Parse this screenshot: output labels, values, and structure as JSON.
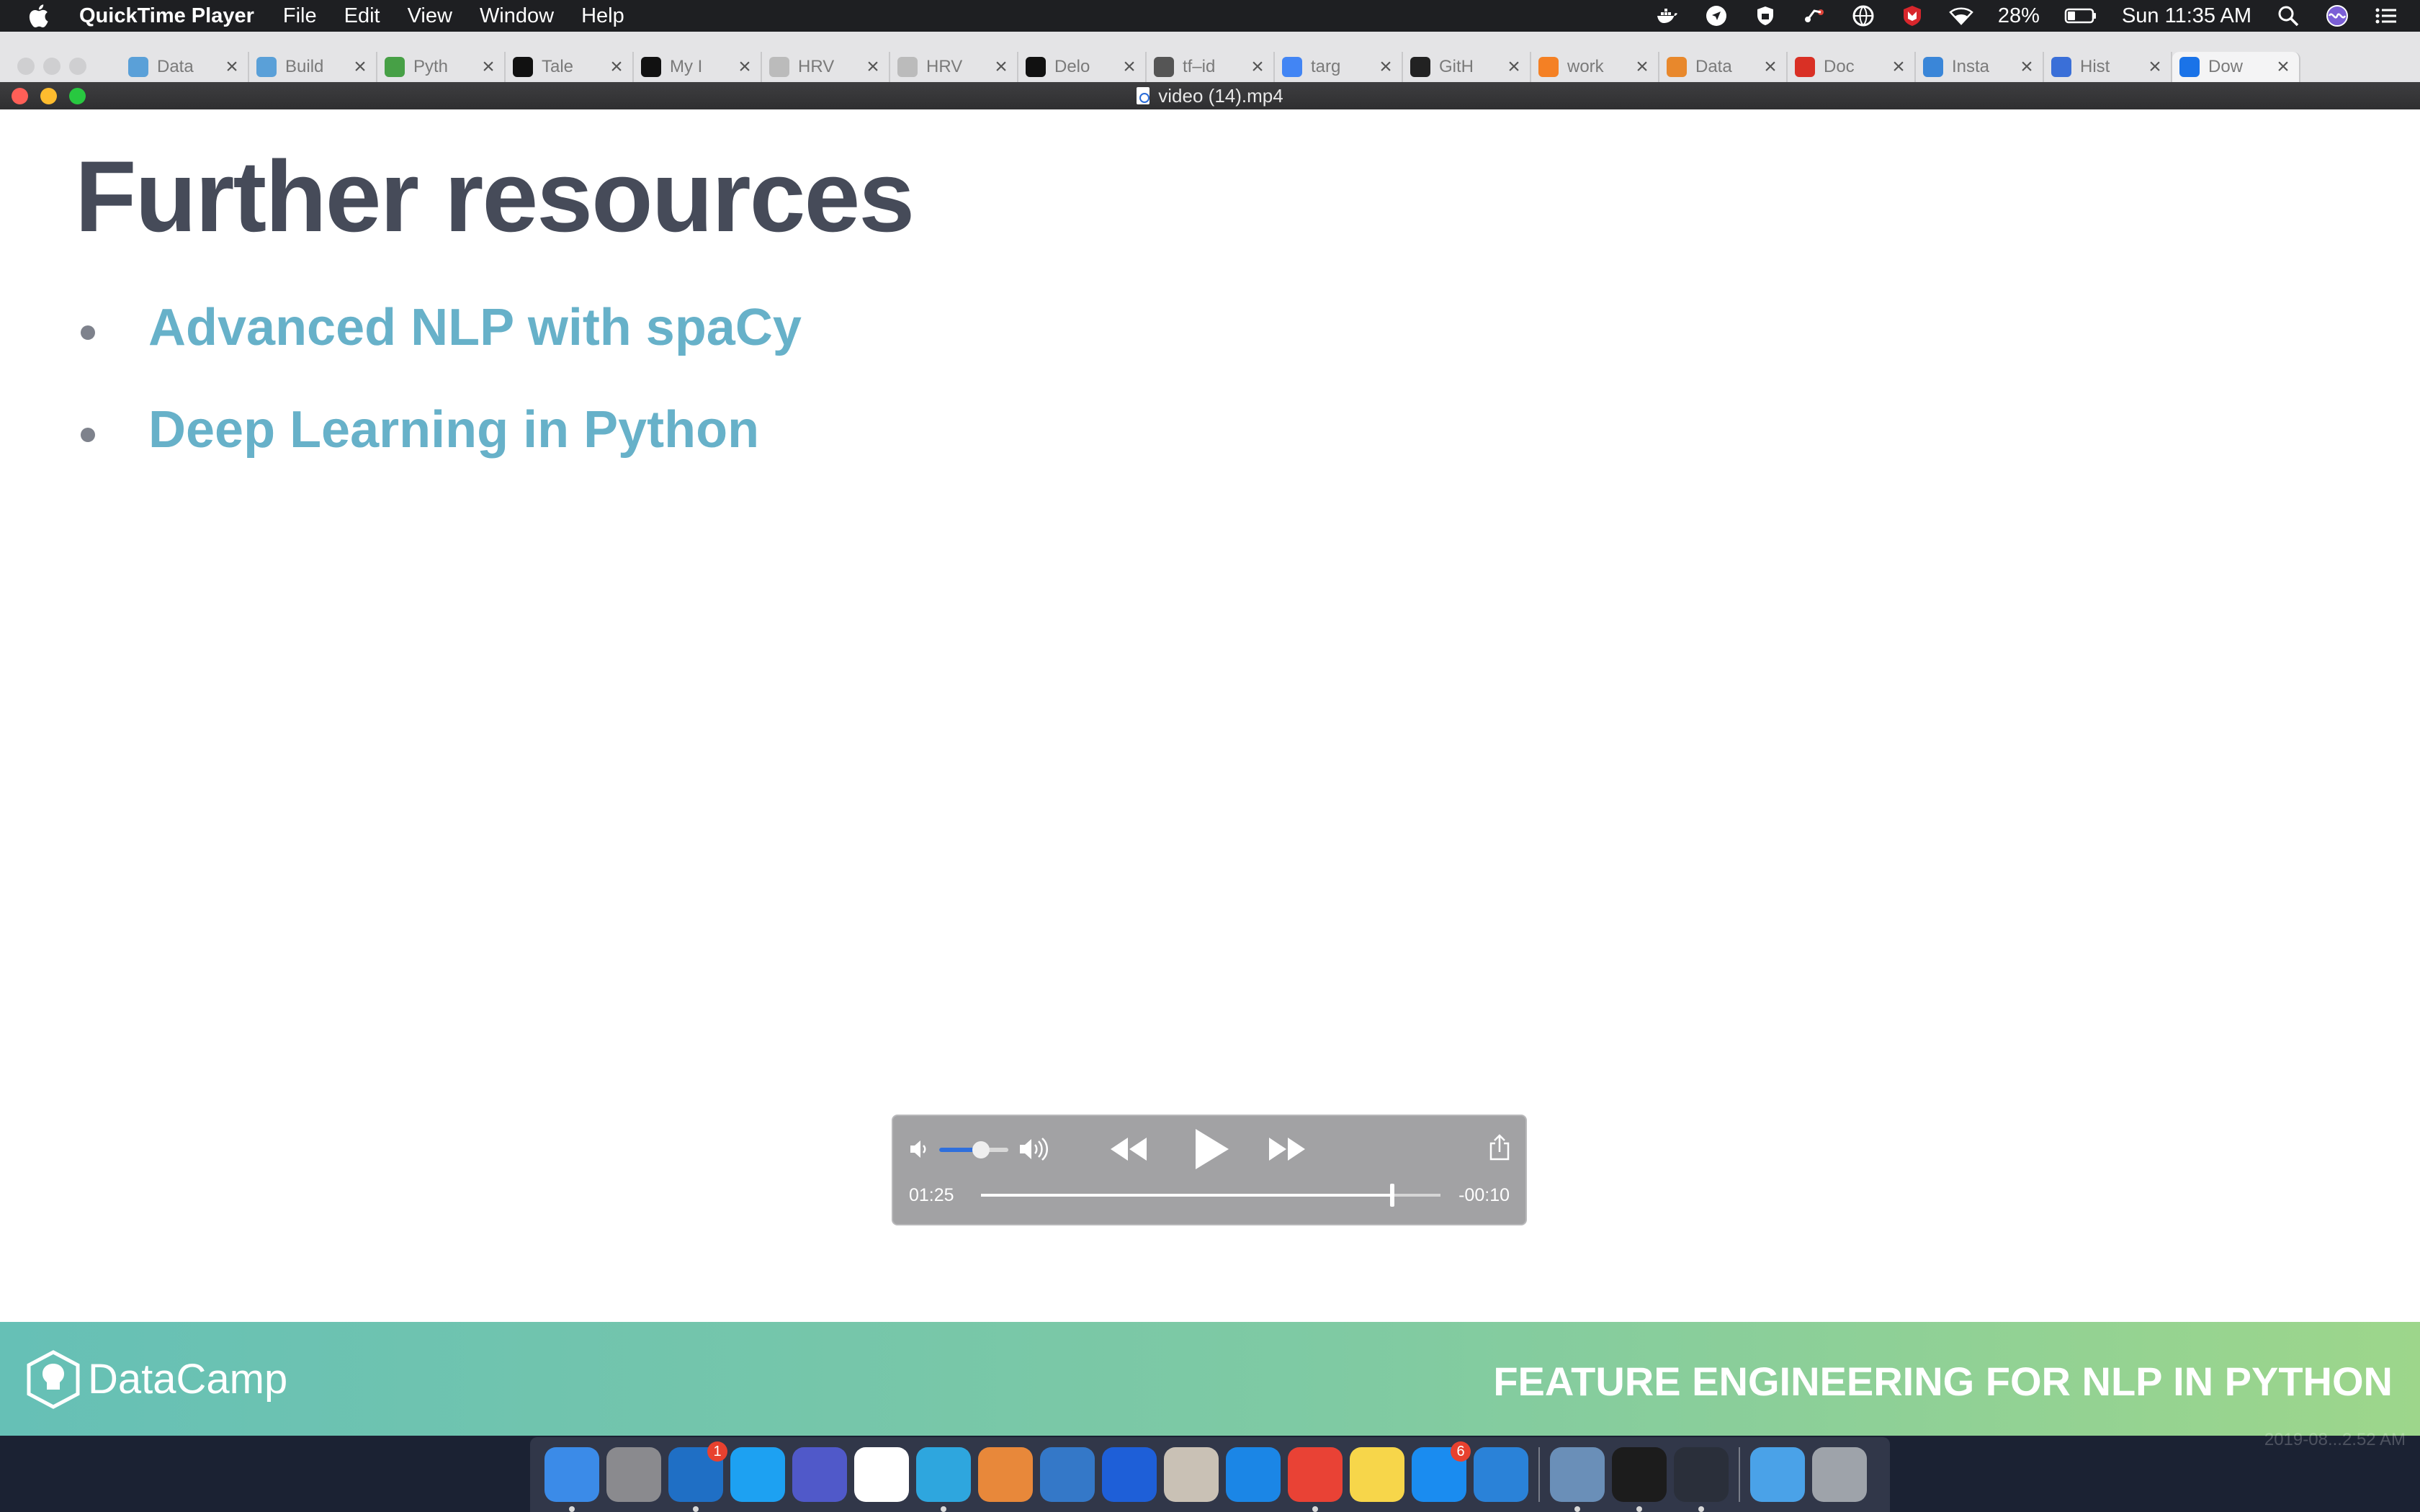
{
  "menubar": {
    "app_name": "QuickTime Player",
    "items": [
      "File",
      "Edit",
      "View",
      "Window",
      "Help"
    ],
    "battery": "28%",
    "clock": "Sun 11:35 AM",
    "status_icons": [
      "docker-icon",
      "navigation-icon",
      "shield-icon",
      "activity-icon",
      "globe-vpn-icon",
      "mcafee-icon",
      "wifi-icon",
      "battery-icon",
      "spotlight-search-icon",
      "siri-icon",
      "notification-center-icon"
    ]
  },
  "browser_tabs": [
    {
      "title": "Data",
      "favicon_color": "#5aa0d8"
    },
    {
      "title": "Build",
      "favicon_color": "#5aa0d8"
    },
    {
      "title": "Pyth",
      "favicon_color": "#47a046"
    },
    {
      "title": "Tale",
      "favicon_color": "#111111"
    },
    {
      "title": "My I",
      "favicon_color": "#111111"
    },
    {
      "title": "HRV",
      "favicon_color": "#bbbbbb"
    },
    {
      "title": "HRV",
      "favicon_color": "#bbbbbb"
    },
    {
      "title": "Delo",
      "favicon_color": "#111111"
    },
    {
      "title": "tf–id",
      "favicon_color": "#555555"
    },
    {
      "title": "targ",
      "favicon_color": "#4285f4"
    },
    {
      "title": "GitH",
      "favicon_color": "#222222"
    },
    {
      "title": "work",
      "favicon_color": "#f48024"
    },
    {
      "title": "Data",
      "favicon_color": "#e8882c"
    },
    {
      "title": "Doc",
      "favicon_color": "#d93025"
    },
    {
      "title": "Insta",
      "favicon_color": "#3a86d8"
    },
    {
      "title": "Hist",
      "favicon_color": "#3a6fd8"
    },
    {
      "title": "Dow",
      "favicon_color": "#1a73e8",
      "active": true
    }
  ],
  "window": {
    "title": "video (14).mp4"
  },
  "slide": {
    "title": "Further resources",
    "resources": [
      "Advanced NLP with spaCy",
      "Deep Learning in Python"
    ],
    "brand": "DataCamp",
    "course": "FEATURE ENGINEERING FOR NLP IN PYTHON"
  },
  "player": {
    "elapsed": "01:25",
    "remaining": "-00:10",
    "progress": 0.895,
    "volume": 0.6,
    "accent_color": "#2f6fdc"
  },
  "dock": {
    "apps": [
      {
        "name": "finder-icon",
        "color": "#3b8be8",
        "running": true
      },
      {
        "name": "system-preferences-icon",
        "color": "#8a8a8e"
      },
      {
        "name": "outlook-icon",
        "color": "#1f6fc5",
        "badge": "1",
        "running": true
      },
      {
        "name": "skype-icon",
        "color": "#1da1f2"
      },
      {
        "name": "teams-icon",
        "color": "#5059c9"
      },
      {
        "name": "slack-icon",
        "color": "#ffffff"
      },
      {
        "name": "telegram-icon",
        "color": "#2ea6de",
        "running": true
      },
      {
        "name": "vpn-flower-icon",
        "color": "#e8883a"
      },
      {
        "name": "xcode-icon",
        "color": "#3478c8"
      },
      {
        "name": "maps-pin-icon",
        "color": "#1e5fd8"
      },
      {
        "name": "jug-app-icon",
        "color": "#c9c1b5"
      },
      {
        "name": "safari-icon",
        "color": "#1b86e6"
      },
      {
        "name": "chrome-icon",
        "color": "#e94235",
        "running": true
      },
      {
        "name": "notes-icon",
        "color": "#f7d64a"
      },
      {
        "name": "app-store-icon",
        "color": "#1a8cf0",
        "badge": "6"
      },
      {
        "name": "simulator-icon",
        "color": "#2a82d8"
      },
      {
        "name": "preview-icon",
        "color": "#6a8fb8",
        "separator_before": true,
        "running": true
      },
      {
        "name": "terminal-icon",
        "color": "#1c1c1c",
        "running": true
      },
      {
        "name": "quicktime-icon",
        "color": "#2a2f3a",
        "running": true
      },
      {
        "name": "downloads-folder-icon",
        "color": "#4aa2e8",
        "separator_before": true
      },
      {
        "name": "trash-icon",
        "color": "#9ea3aa"
      }
    ]
  },
  "corner_stamp": "2019-08...2.52 AM"
}
